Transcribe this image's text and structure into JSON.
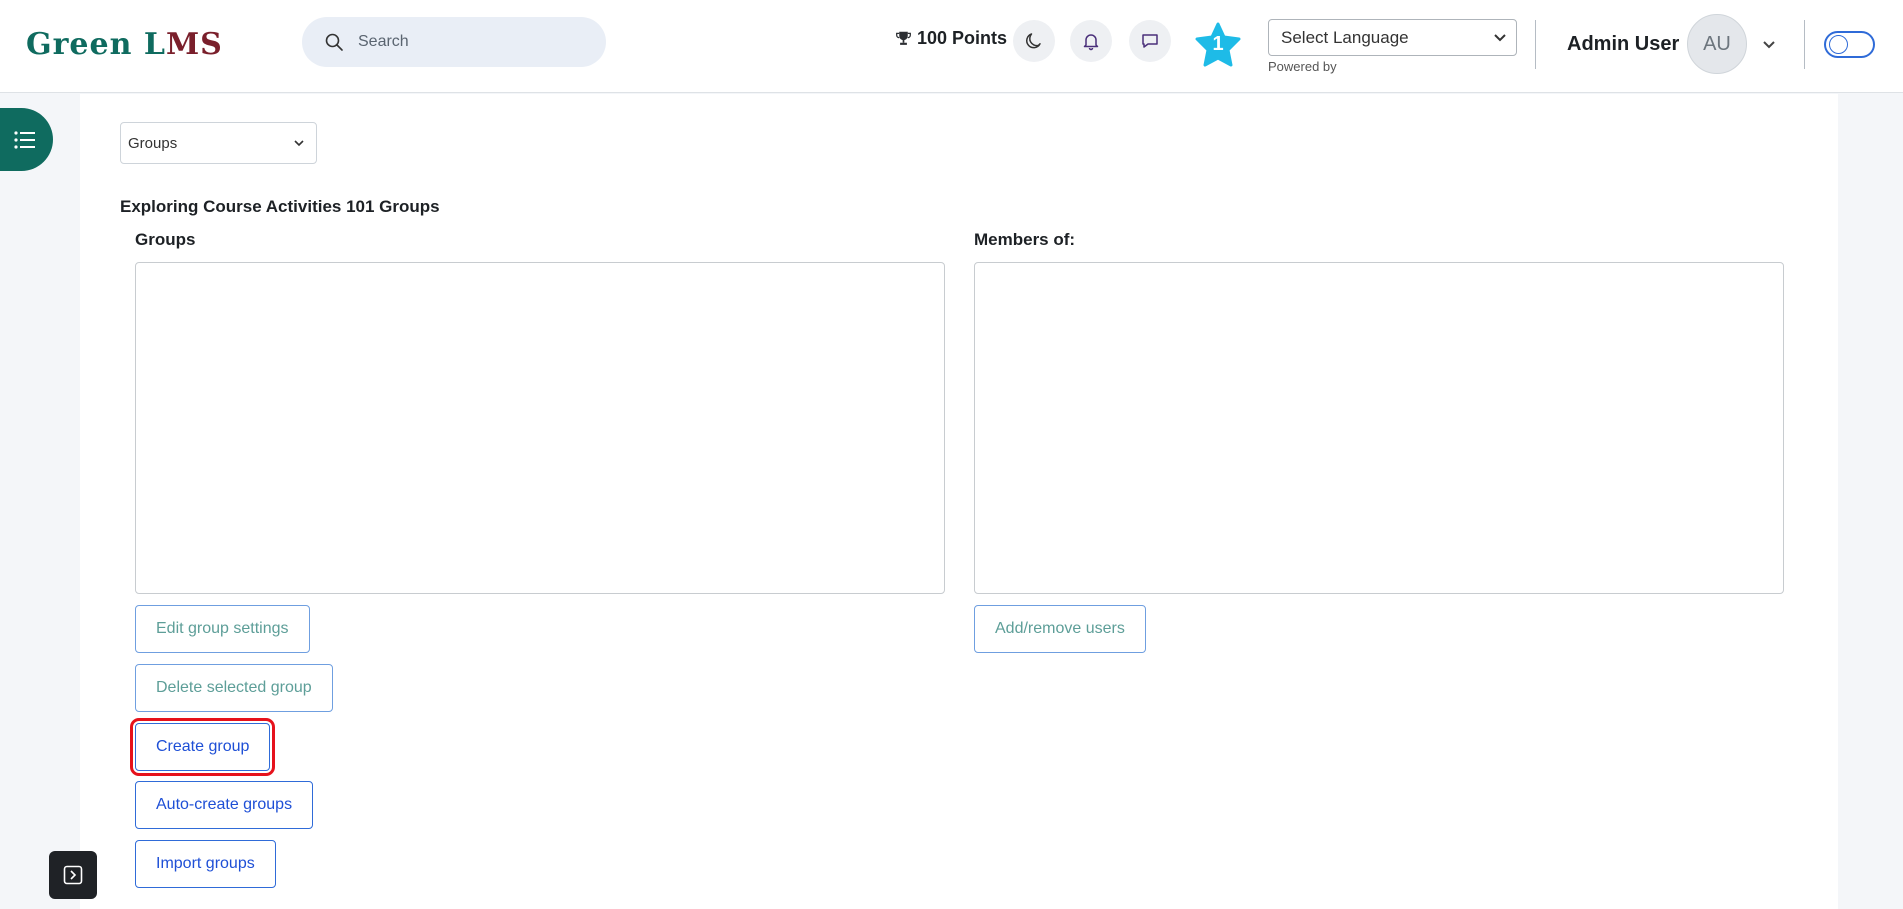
{
  "header": {
    "logo_text_1": "Green L",
    "logo_text_2": "MS",
    "search_placeholder": "Search",
    "points": "100 Points",
    "notification_count": "1",
    "language_select": "Select Language",
    "powered_by": "Powered by",
    "user_name": "Admin User",
    "avatar_initials": "AU"
  },
  "main": {
    "groups_select": "Groups",
    "heading": "Exploring Course Activities 101 Groups",
    "groups_label": "Groups",
    "members_label": "Members of:",
    "buttons": {
      "edit": "Edit group settings",
      "delete": "Delete selected group",
      "create": "Create group",
      "auto_create": "Auto-create groups",
      "import": "Import groups",
      "add_remove": "Add/remove users"
    }
  },
  "colors": {
    "brand": "#0f6b5f",
    "accent_blue": "#1e4fd6",
    "highlight": "#e6121c"
  }
}
